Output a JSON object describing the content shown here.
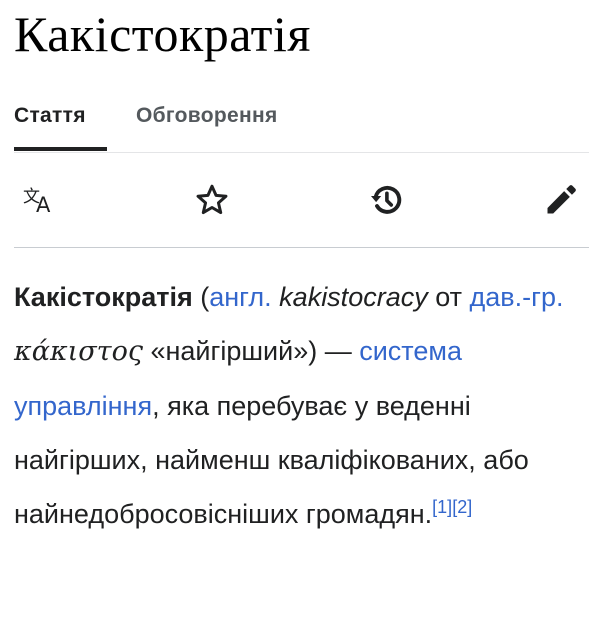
{
  "page": {
    "title": "Какістократія"
  },
  "tabs": [
    {
      "label": "Стаття",
      "selected": true
    },
    {
      "label": "Обговорення",
      "selected": false
    }
  ],
  "toolbar": {
    "icons": [
      "language-icon",
      "star-icon",
      "history-icon",
      "edit-pencil-icon"
    ]
  },
  "article": {
    "term": "Какістократія",
    "open_paren": " (",
    "lang_en_link": "англ.",
    "en_word": "kakistocracy",
    "from_text": " от ",
    "lang_grc_link": "дав.-гр.",
    "greek_word": "κάκιστος",
    "meaning": " «найгірший») — ",
    "system_link": "система управління",
    "rest_text": ", яка перебуває у веденні найгірших, найменш кваліфікованих, або найнедобросовісніших громадян.",
    "ref1": "[1]",
    "ref2": "[2]"
  },
  "colors": {
    "text": "#202122",
    "link": "#3366cc",
    "tab_inactive": "#54595d",
    "divider": "#c8ccd1"
  }
}
